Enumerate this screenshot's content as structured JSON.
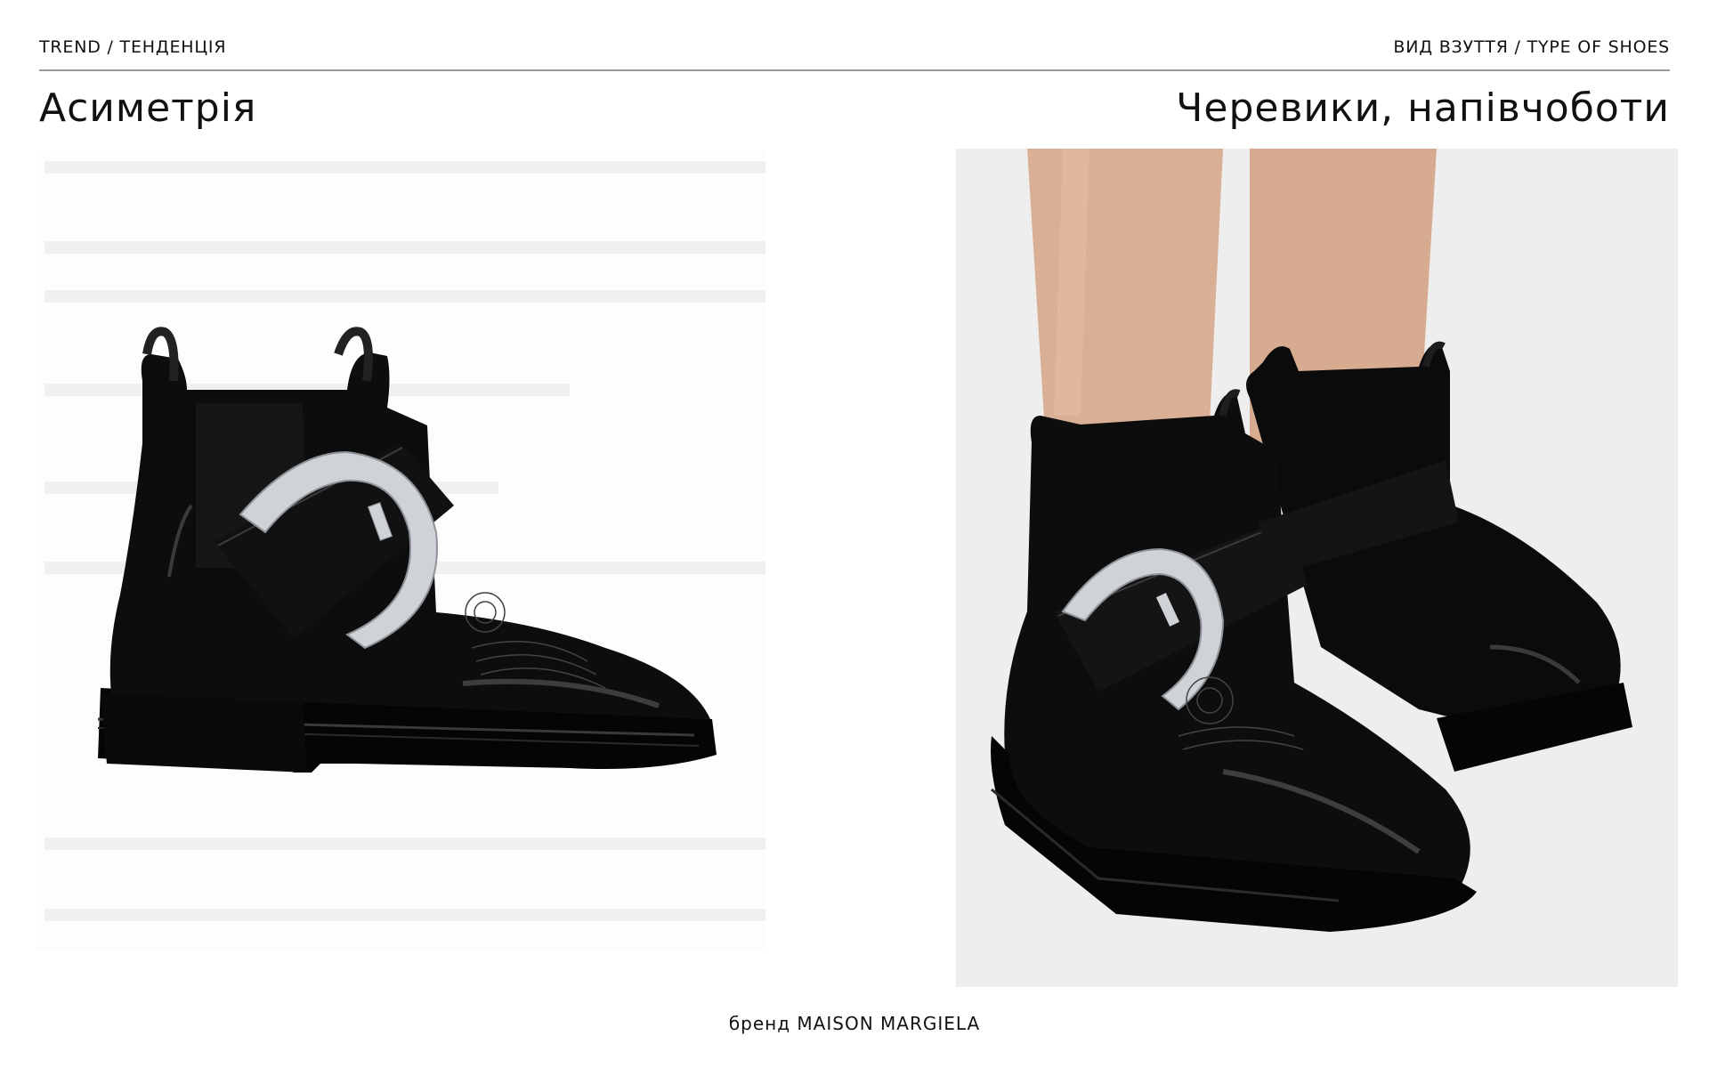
{
  "header": {
    "left_label": "TREND / ТЕНДЕНЦІЯ",
    "right_label": "ВИД ВЗУТТЯ / TYPE OF SHOES"
  },
  "titles": {
    "trend": "Асиметрія",
    "shoe_type": "Черевики, напівчоботи"
  },
  "images": {
    "left": "boot-product-photo",
    "right": "boots-worn-photo"
  },
  "footer": {
    "brand_line": "бренд MAISON MARGIELA"
  },
  "colors": {
    "rule": "#9a9a9a",
    "boot_black": "#0d0d0d",
    "buckle_silver": "#cfd2d6",
    "skin": "#d9b095",
    "backdrop": "#eeeeee"
  }
}
